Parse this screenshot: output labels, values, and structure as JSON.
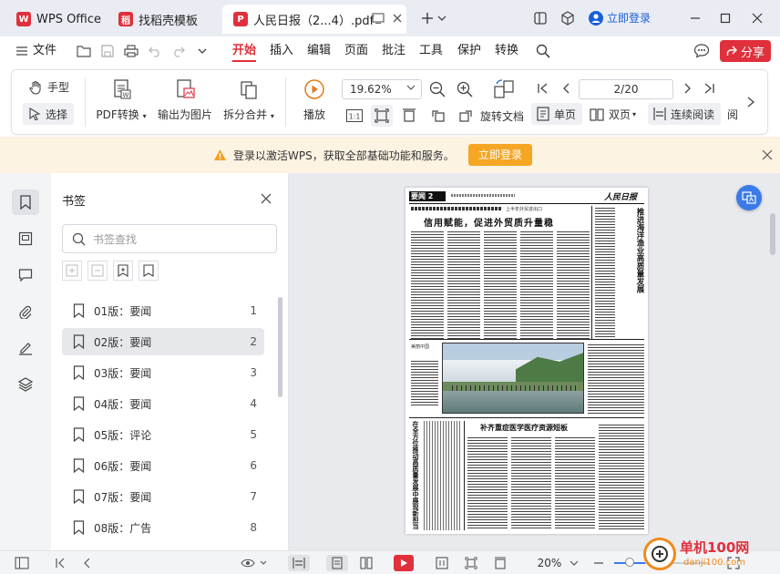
{
  "tabs": [
    {
      "label": "WPS Office"
    },
    {
      "label": "找稻壳模板"
    },
    {
      "label": "人民日报（2...4）.pdf"
    }
  ],
  "titlebar": {
    "login_label": "立即登录"
  },
  "menubar": {
    "file_label": "文件",
    "items": [
      "开始",
      "插入",
      "编辑",
      "页面",
      "批注",
      "工具",
      "保护",
      "转换"
    ],
    "share_label": "分享"
  },
  "ribbon": {
    "hand_label": "手型",
    "select_label": "选择",
    "pdf_convert_label": "PDF转换",
    "export_image_label": "输出为图片",
    "split_merge_label": "拆分合并",
    "play_label": "播放",
    "zoom_value": "19.62%",
    "page_value": "2/20",
    "rotate_label": "旋转文档",
    "single_label": "单页",
    "double_label": "双页",
    "continuous_label": "连续阅读",
    "read_label": "阅"
  },
  "notice": {
    "text": "登录以激活WPS，获取全部基础功能和服务。",
    "button_label": "立即登录"
  },
  "bookmarks": {
    "title": "书签",
    "search_placeholder": "书签查找",
    "items": [
      {
        "label": "01版：要闻",
        "page": "1"
      },
      {
        "label": "02版：要闻",
        "page": "2"
      },
      {
        "label": "03版：要闻",
        "page": "3"
      },
      {
        "label": "04版：要闻",
        "page": "4"
      },
      {
        "label": "05版：评论",
        "page": "5"
      },
      {
        "label": "06版：要闻",
        "page": "6"
      },
      {
        "label": "07版：要闻",
        "page": "7"
      },
      {
        "label": "08版：广告",
        "page": "8"
      }
    ]
  },
  "newspaper": {
    "section": "要闻 2",
    "masthead": "人民日报",
    "headline_kicker": "上半年外贸进出口",
    "headline": "信用赋能，促进外贸质升量稳",
    "side_headline": "推进海洋渔业高质量发展",
    "photo_caption": "美丽中国",
    "lower_headline": "补齐重症医学医疗资源短板",
    "left_vertical": "在全方位推动高质量发展中展现新担当"
  },
  "statusbar": {
    "zoom_value": "20%"
  },
  "watermark": {
    "site": "单机100网",
    "url": "danji100.com"
  },
  "colors": {
    "accent": "#e0303c",
    "notice_bg": "#fdf3e3",
    "notice_btn": "#f5a623",
    "link_blue": "#1a5fd6"
  }
}
